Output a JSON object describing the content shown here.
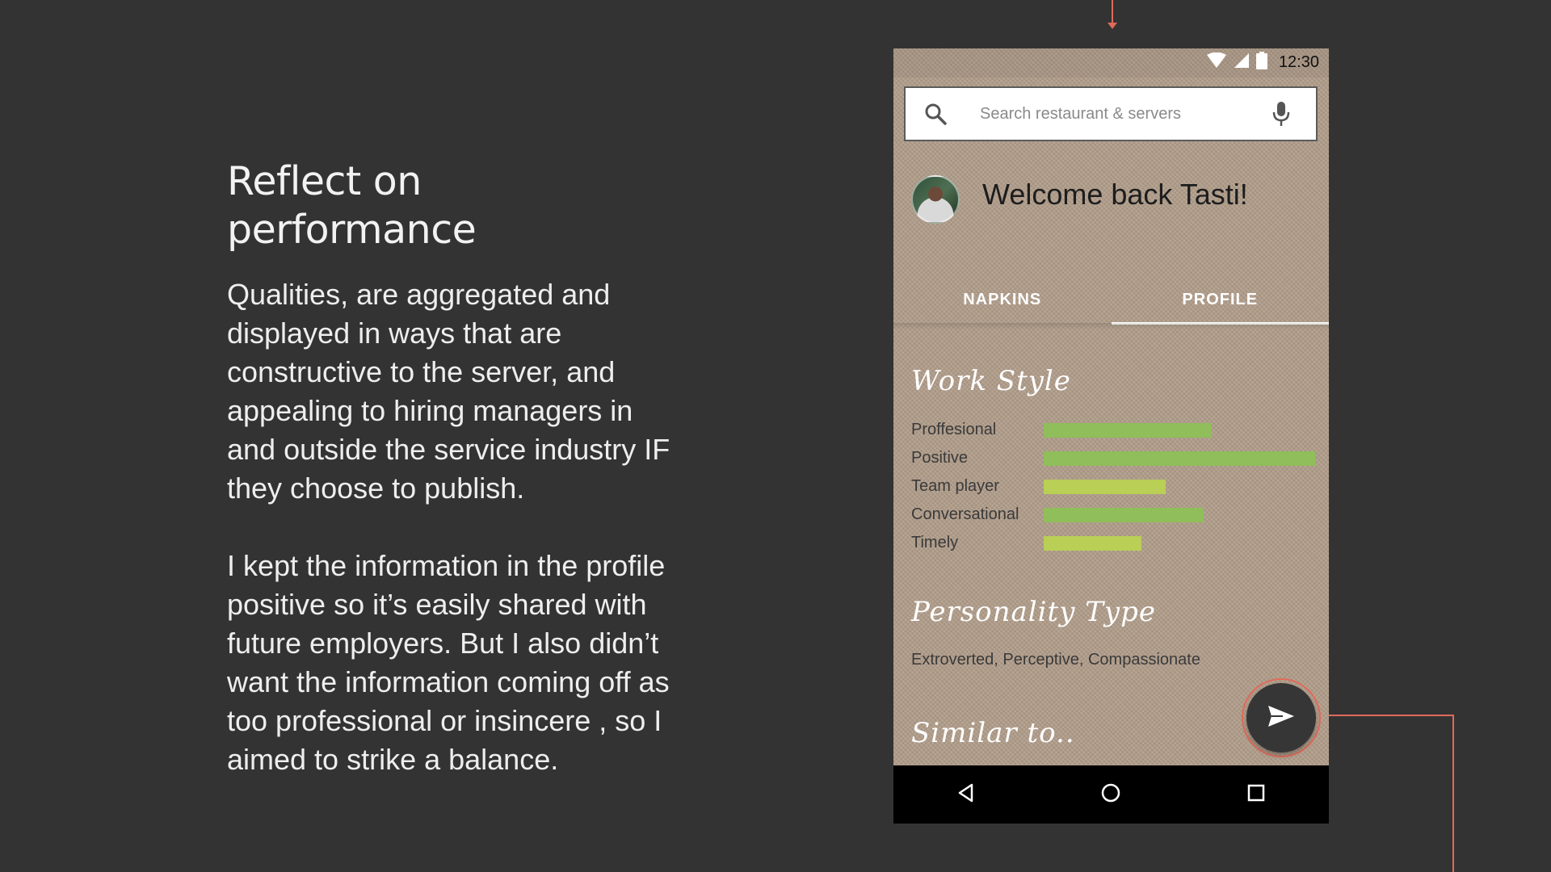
{
  "copy": {
    "title": "Reflect on performance",
    "paragraph1": "Qualities, are aggregated and displayed in ways that are constructive to the server, and appealing to hiring managers in and outside the service industry IF they choose to publish.",
    "paragraph2": "I kept the information in the profile positive so it’s easily shared with future employers. But I also didn’t want the information coming off as too professional or insincere , so I aimed to strike a balance."
  },
  "status_bar": {
    "time": "12:30"
  },
  "search": {
    "placeholder": "Search restaurant & servers"
  },
  "header": {
    "welcome": "Welcome back Tasti!"
  },
  "tabs": [
    {
      "label": "NAPKINS",
      "active": false
    },
    {
      "label": "PROFILE",
      "active": true
    }
  ],
  "work_style": {
    "title": "Work Style",
    "items": [
      {
        "label": "Proffesional",
        "fraction": 0.62,
        "color": "#8fbe5a"
      },
      {
        "label": "Positive",
        "fraction": 1.0,
        "color": "#8fbe5a"
      },
      {
        "label": "Team player",
        "fraction": 0.45,
        "color": "#b9cf56"
      },
      {
        "label": "Conversational",
        "fraction": 0.59,
        "color": "#8fbe5a"
      },
      {
        "label": "Timely",
        "fraction": 0.36,
        "color": "#b9cf56"
      }
    ]
  },
  "personality": {
    "title": "Personality Type",
    "text": "Extroverted, Perceptive, Compassionate"
  },
  "similar": {
    "title": "Similar to.."
  },
  "icons": {
    "search": "search-icon",
    "mic": "mic-icon",
    "send": "send-icon",
    "back": "back-icon",
    "home": "home-icon",
    "recents": "recents-icon"
  },
  "colors": {
    "accent_line": "#e06a5a",
    "background": "#333333"
  }
}
